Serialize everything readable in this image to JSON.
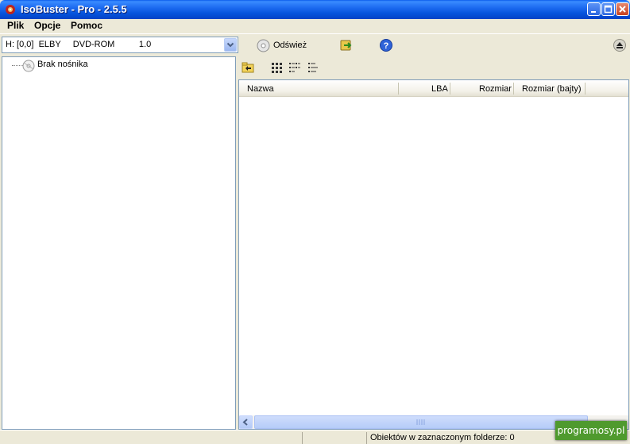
{
  "window": {
    "title": "IsoBuster - Pro - 2.5.5"
  },
  "menu": [
    {
      "label": "Plik"
    },
    {
      "label": "Opcje"
    },
    {
      "label": "Pomoc"
    }
  ],
  "toolbar": {
    "drive_selected": "H: [0,0]  ELBY     DVD-ROM          1.0",
    "refresh_label": "Odśwież"
  },
  "tree": {
    "root_label": "Brak nośnika"
  },
  "list": {
    "columns": [
      "Nazwa",
      "LBA",
      "Rozmiar",
      "Rozmiar (bajty)"
    ],
    "rows": []
  },
  "status": {
    "objects_text": "Obiektów w zaznaczonym folderze: 0"
  },
  "watermark": {
    "text": "programosy.pl"
  },
  "colors": {
    "titlebar": "#0653DC",
    "face": "#ECE9D8",
    "border": "#7F9DB9",
    "watermark_bg": "#4F9A2E"
  }
}
